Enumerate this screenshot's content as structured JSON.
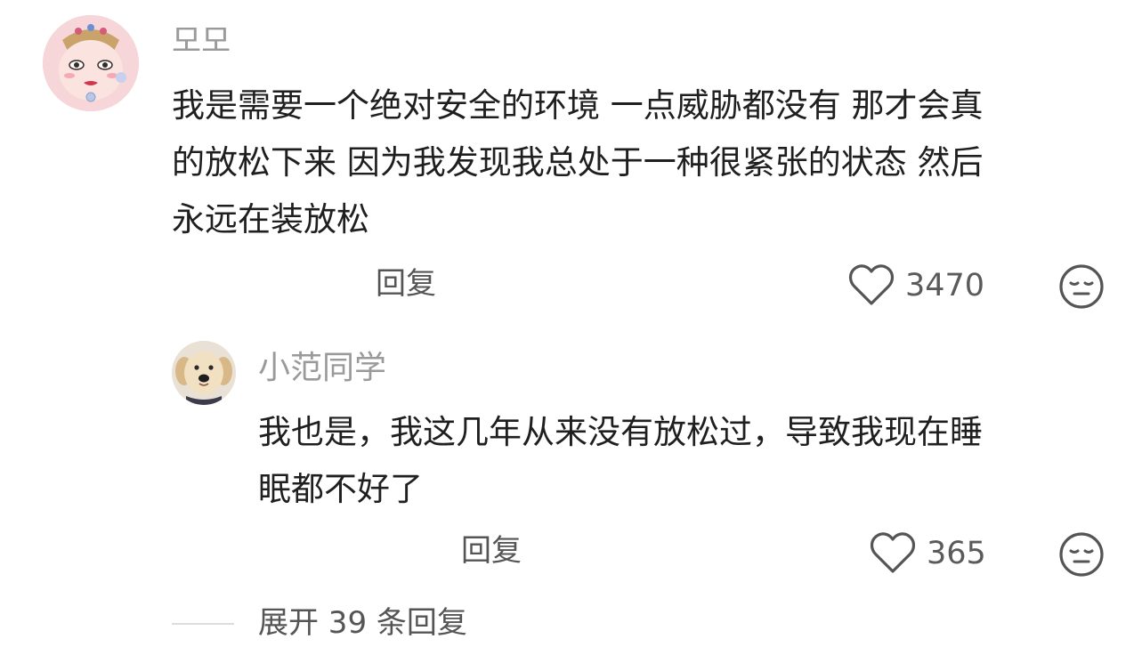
{
  "comment": {
    "username": "모모",
    "text_lines": [
      "我是需要一个绝对安全的环境 一点威胁都没有 那才会真",
      "的放松下来 因为我发现我总处于一种很紧张的状态 然后",
      "永远在装放松"
    ],
    "reply_label": "回复",
    "like_count": "3470",
    "avatar_icon": "cartoon-girl-avatar-icon",
    "like_icon": "heart-outline-icon",
    "dislike_icon": "meh-face-icon"
  },
  "reply": {
    "username": "小范同学",
    "text_lines": [
      "我也是，我这几年从来没有放松过，导致我现在睡",
      "眠都不好了"
    ],
    "reply_label": "回复",
    "like_count": "365",
    "avatar_icon": "golden-retriever-puppy-avatar-icon",
    "like_icon": "heart-outline-icon",
    "dislike_icon": "meh-face-icon"
  },
  "expand": {
    "label": "展开 39 条回复"
  },
  "colors": {
    "username": "#9a9a9a",
    "body_text": "#1f1f1f",
    "action_text": "#555555",
    "icon_stroke": "#555555",
    "background": "#ffffff"
  }
}
